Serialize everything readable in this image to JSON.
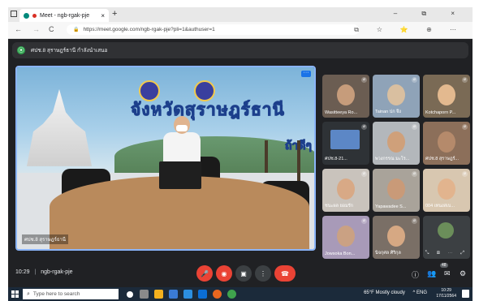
{
  "browser": {
    "tab_title": "Meet - ngb-rgak-pje",
    "tab_close": "×",
    "new_tab": "+",
    "window_controls": "– ⧉ ×",
    "url": "https://meet.google.com/ngb-rgak-pje?pli=1&authuser=1",
    "nav_back": "←",
    "nav_forward": "→",
    "nav_reload": "C",
    "right_icons": "⧉ ☆ ⭐ ⊕ ⋯"
  },
  "meet": {
    "notice_text": "ศปช.8 สุราษฎร์ธานี กำลังนำเสนอ",
    "notice_icon": "⦿",
    "main_video": {
      "banner_text": "จังหวัดสุราษฎร์ธานี",
      "banner_text_2": "ถ้าดีๆ",
      "presenter_name": "ศปช.8 สุราษฎร์ธานี",
      "more_icon": "···"
    },
    "participants": [
      {
        "name": "Wasitteeya Ro..."
      },
      {
        "name": "Tainan ปก จึง"
      },
      {
        "name": "Kotchaporn P..."
      },
      {
        "name": "ศปช.8-21..."
      },
      {
        "name": "พวงกรรณ มะโร..."
      },
      {
        "name": "ศปช.8 สุราษฎร์..."
      },
      {
        "name": "ชนะผล ยอมรัก"
      },
      {
        "name": "Yapawadee S..."
      },
      {
        "name": "004 เทนงสเบ..."
      },
      {
        "name": "Jowsoka Bon..."
      },
      {
        "name": "นิจกุศล ศิริกุล"
      }
    ],
    "others_controls": "⤡ ⊠ ⋯ ⤢",
    "bottom": {
      "time": "10:29",
      "separator": "|",
      "meeting_code": "ngb-rgak-pje",
      "mic_icon": "🎤",
      "cam_icon": "◉",
      "present_icon": "▣",
      "more_icon": "⋮",
      "leave_icon": "☎",
      "info_icon": "ⓘ",
      "people_icon": "👥",
      "people_count": "48",
      "chat_icon": "✉",
      "activities_icon": "⚙"
    }
  },
  "taskbar": {
    "search_placeholder": "Type here to search",
    "search_icon": "⌕",
    "weather": "65°F  Mostly cloudy",
    "tray_icons": "^ ENG",
    "time": "10:29",
    "date": "17/11/2564"
  },
  "colors": {
    "meet_bg": "#202124",
    "active_border": "#8ab4f8",
    "red": "#ea4335",
    "taskbar": "#1b2a3a"
  }
}
